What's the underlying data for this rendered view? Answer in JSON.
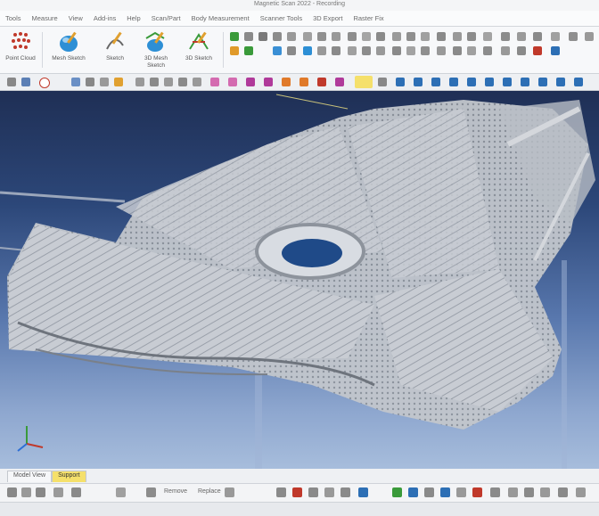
{
  "window": {
    "title": "Magnetic Scan 2022 - Recording"
  },
  "menu": [
    "Tools",
    "Measure",
    "View",
    "Add-ins",
    "Help",
    "Scan/Part",
    "Body Measurement",
    "Scanner Tools",
    "3D Export",
    "Raster Fix"
  ],
  "ribbon": {
    "buttons": [
      {
        "label": "Point Cloud",
        "icon": "point-cloud-icon"
      },
      {
        "label": "Mesh Sketch",
        "icon": "mesh-sketch-icon"
      },
      {
        "label": "Sketch",
        "icon": "sketch-icon"
      },
      {
        "label": "3D Mesh Sketch",
        "icon": "3d-mesh-sketch-icon"
      },
      {
        "label": "3D Sketch",
        "icon": "3d-sketch-icon"
      }
    ]
  },
  "tabs": [
    "Model View",
    "Support"
  ],
  "bottom": {
    "labels": [
      "Remove",
      "Replace"
    ]
  },
  "colors": {
    "accent": "#f5e06b",
    "viewport_top": "#1f2f55",
    "viewport_bottom": "#a7bddc"
  }
}
